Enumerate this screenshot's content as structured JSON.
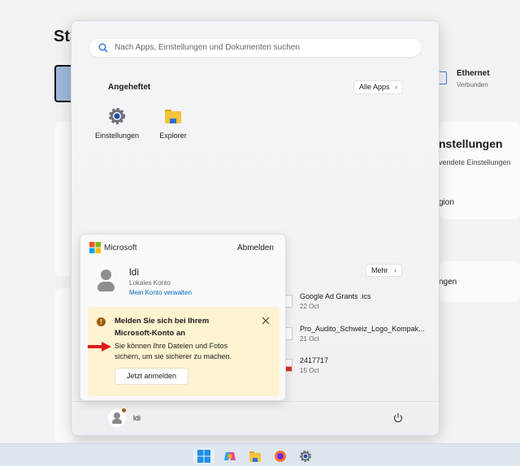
{
  "background": {
    "title_partial": "Sta",
    "ethernet_label": "Ethernet",
    "ethernet_status": "Verbunden",
    "section_title_partial": "nstellungen",
    "section_sub_partial": "vendete Einstellungen",
    "item1_partial": "gion",
    "item2_partial": "ngen"
  },
  "start_menu": {
    "search_placeholder": "Nach Apps, Einstellungen und Dokumenten suchen",
    "pinned_title": "Angeheftet",
    "all_apps_label": "Alle Apps",
    "pinned": [
      {
        "label": "Einstellungen",
        "icon": "gear-icon"
      },
      {
        "label": "Explorer",
        "icon": "folder-icon"
      }
    ],
    "more_label": "Mehr",
    "recent": [
      {
        "name": "Google Ad Grants .ics",
        "date": "22 Oct"
      },
      {
        "name": "Pro_Audito_Schweiz_Logo_Kompak...",
        "date": "21 Oct"
      },
      {
        "name": "2417717",
        "date": "15 Oct"
      }
    ],
    "footer_user": "ldi"
  },
  "account_flyout": {
    "brand": "Microsoft",
    "sign_out": "Abmelden",
    "user_name": "ldi",
    "account_type": "Lokales Konto",
    "manage_link": "Mein Konto verwalten",
    "warning": {
      "title_line1": "Melden Sie sich bei Ihrem",
      "title_line2": "Microsoft-Konto an",
      "body_line1": "Sie können Ihre Dateien und Fotos",
      "body_line2": "sichern, um sie sicherer zu machen.",
      "button": "Jetzt anmelden"
    }
  },
  "colors": {
    "link": "#0067c0",
    "warning_bg": "#fdf3d1",
    "arrow": "#e01b1b"
  }
}
